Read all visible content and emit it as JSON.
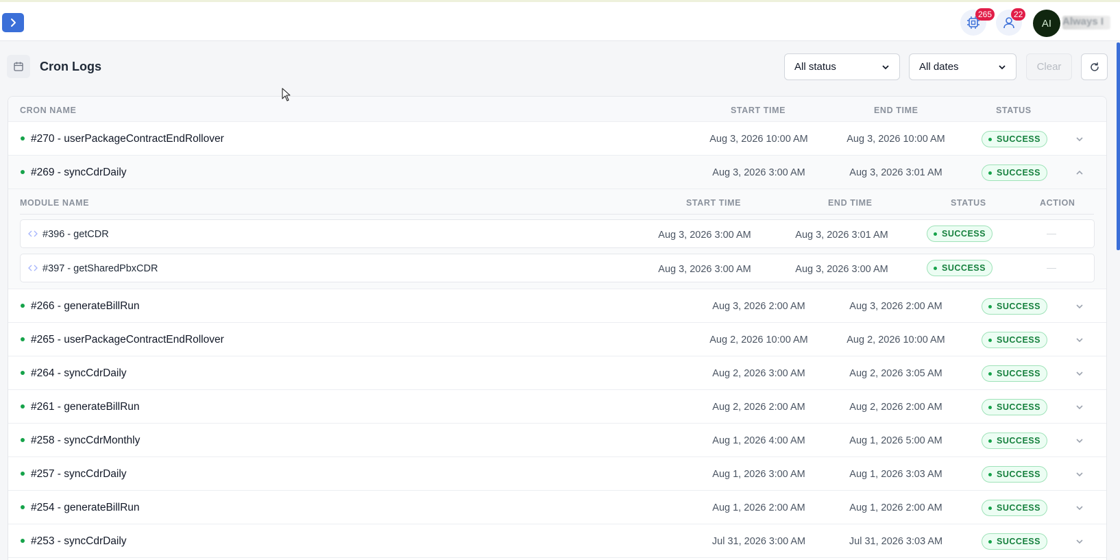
{
  "header": {
    "badge_tasks": "265",
    "badge_users": "22",
    "avatar_initials": "AI",
    "username": "Always I"
  },
  "page": {
    "title": "Cron Logs",
    "status_filter": "All status",
    "date_filter": "All dates",
    "clear_label": "Clear"
  },
  "table": {
    "columns": {
      "name": "CRON NAME",
      "start": "START TIME",
      "end": "END TIME",
      "status": "STATUS"
    },
    "rows": [
      {
        "name": "#270 - userPackageContractEndRollover",
        "start": "Aug 3, 2026 10:00 AM",
        "end": "Aug 3, 2026 10:00 AM",
        "status": "SUCCESS"
      },
      {
        "name": "#269 - syncCdrDaily",
        "start": "Aug 3, 2026 3:00 AM",
        "end": "Aug 3, 2026 3:01 AM",
        "status": "SUCCESS"
      },
      {
        "name": "#266 - generateBillRun",
        "start": "Aug 3, 2026 2:00 AM",
        "end": "Aug 3, 2026 2:00 AM",
        "status": "SUCCESS"
      },
      {
        "name": "#265 - userPackageContractEndRollover",
        "start": "Aug 2, 2026 10:00 AM",
        "end": "Aug 2, 2026 10:00 AM",
        "status": "SUCCESS"
      },
      {
        "name": "#264 - syncCdrDaily",
        "start": "Aug 2, 2026 3:00 AM",
        "end": "Aug 2, 2026 3:05 AM",
        "status": "SUCCESS"
      },
      {
        "name": "#261 - generateBillRun",
        "start": "Aug 2, 2026 2:00 AM",
        "end": "Aug 2, 2026 2:00 AM",
        "status": "SUCCESS"
      },
      {
        "name": "#258 - syncCdrMonthly",
        "start": "Aug 1, 2026 4:00 AM",
        "end": "Aug 1, 2026 5:00 AM",
        "status": "SUCCESS"
      },
      {
        "name": "#257 - syncCdrDaily",
        "start": "Aug 1, 2026 3:00 AM",
        "end": "Aug 1, 2026 3:03 AM",
        "status": "SUCCESS"
      },
      {
        "name": "#254 - generateBillRun",
        "start": "Aug 1, 2026 2:00 AM",
        "end": "Aug 1, 2026 2:00 AM",
        "status": "SUCCESS"
      },
      {
        "name": "#253 - syncCdrDaily",
        "start": "Jul 31, 2026 3:00 AM",
        "end": "Jul 31, 2026 3:03 AM",
        "status": "SUCCESS"
      }
    ]
  },
  "subtable": {
    "columns": {
      "name": "MODULE NAME",
      "start": "START TIME",
      "end": "END TIME",
      "status": "STATUS",
      "action": "ACTION"
    },
    "rows": [
      {
        "name": "#396 - getCDR",
        "start": "Aug 3, 2026 3:00 AM",
        "end": "Aug 3, 2026 3:01 AM",
        "status": "SUCCESS",
        "action": "—"
      },
      {
        "name": "#397 - getSharedPbxCDR",
        "start": "Aug 3, 2026 3:00 AM",
        "end": "Aug 3, 2026 3:00 AM",
        "status": "SUCCESS",
        "action": "—"
      }
    ]
  },
  "colors": {
    "accent": "#3b6fd8",
    "success": "#16a34a",
    "badge": "#e11d48"
  }
}
